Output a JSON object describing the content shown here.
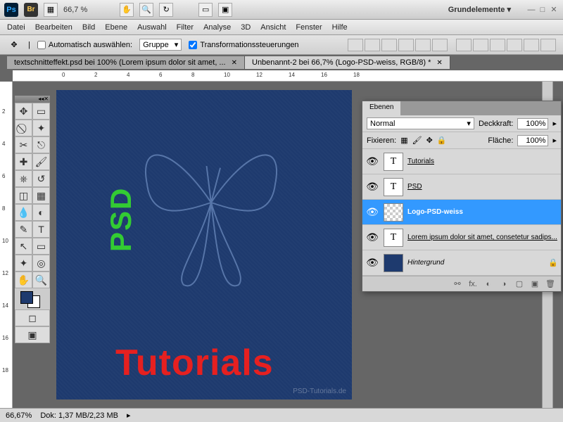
{
  "topbar": {
    "ps": "Ps",
    "br": "Br",
    "zoom": "66,7 %",
    "workspace": "Grundelemente ▾"
  },
  "menu": [
    "Datei",
    "Bearbeiten",
    "Bild",
    "Ebene",
    "Auswahl",
    "Filter",
    "Analyse",
    "3D",
    "Ansicht",
    "Fenster",
    "Hilfe"
  ],
  "options": {
    "autoSelect": "Automatisch auswählen:",
    "groupSelect": "Gruppe",
    "transform": "Transformationssteuerungen"
  },
  "tabs": [
    {
      "label": "textschnitteffekt.psd bei 100% (Lorem ipsum dolor sit amet, ...",
      "active": false
    },
    {
      "label": "Unbenannt-2 bei 66,7% (Logo-PSD-weiss, RGB/8) *",
      "active": true
    }
  ],
  "rulerH": [
    "0",
    "2",
    "4",
    "6",
    "8",
    "10",
    "12",
    "14",
    "16",
    "18"
  ],
  "rulerV": [
    "2",
    "4",
    "6",
    "8",
    "10",
    "12",
    "14",
    "16",
    "18"
  ],
  "canvas": {
    "psd": "PSD",
    "tutorials": "Tutorials",
    "watermark": "PSD-Tutorials.de"
  },
  "status": {
    "zoom": "66,67%",
    "doc": "Dok: 1,37 MB/2,23 MB"
  },
  "layersPanel": {
    "tab": "Ebenen",
    "blendMode": "Normal",
    "opacityLabel": "Deckkraft:",
    "opacity": "100%",
    "lockLabel": "Fixieren:",
    "fillLabel": "Fläche:",
    "fill": "100%",
    "layers": [
      {
        "type": "T",
        "name": "Tutorials"
      },
      {
        "type": "T",
        "name": "PSD"
      },
      {
        "type": "img",
        "name": "Logo-PSD-weiss",
        "selected": true
      },
      {
        "type": "T",
        "name": "Lorem ipsum dolor sit amet, consetetur sadips..."
      },
      {
        "type": "bg",
        "name": "Hintergrund",
        "locked": true,
        "italic": true
      }
    ]
  }
}
